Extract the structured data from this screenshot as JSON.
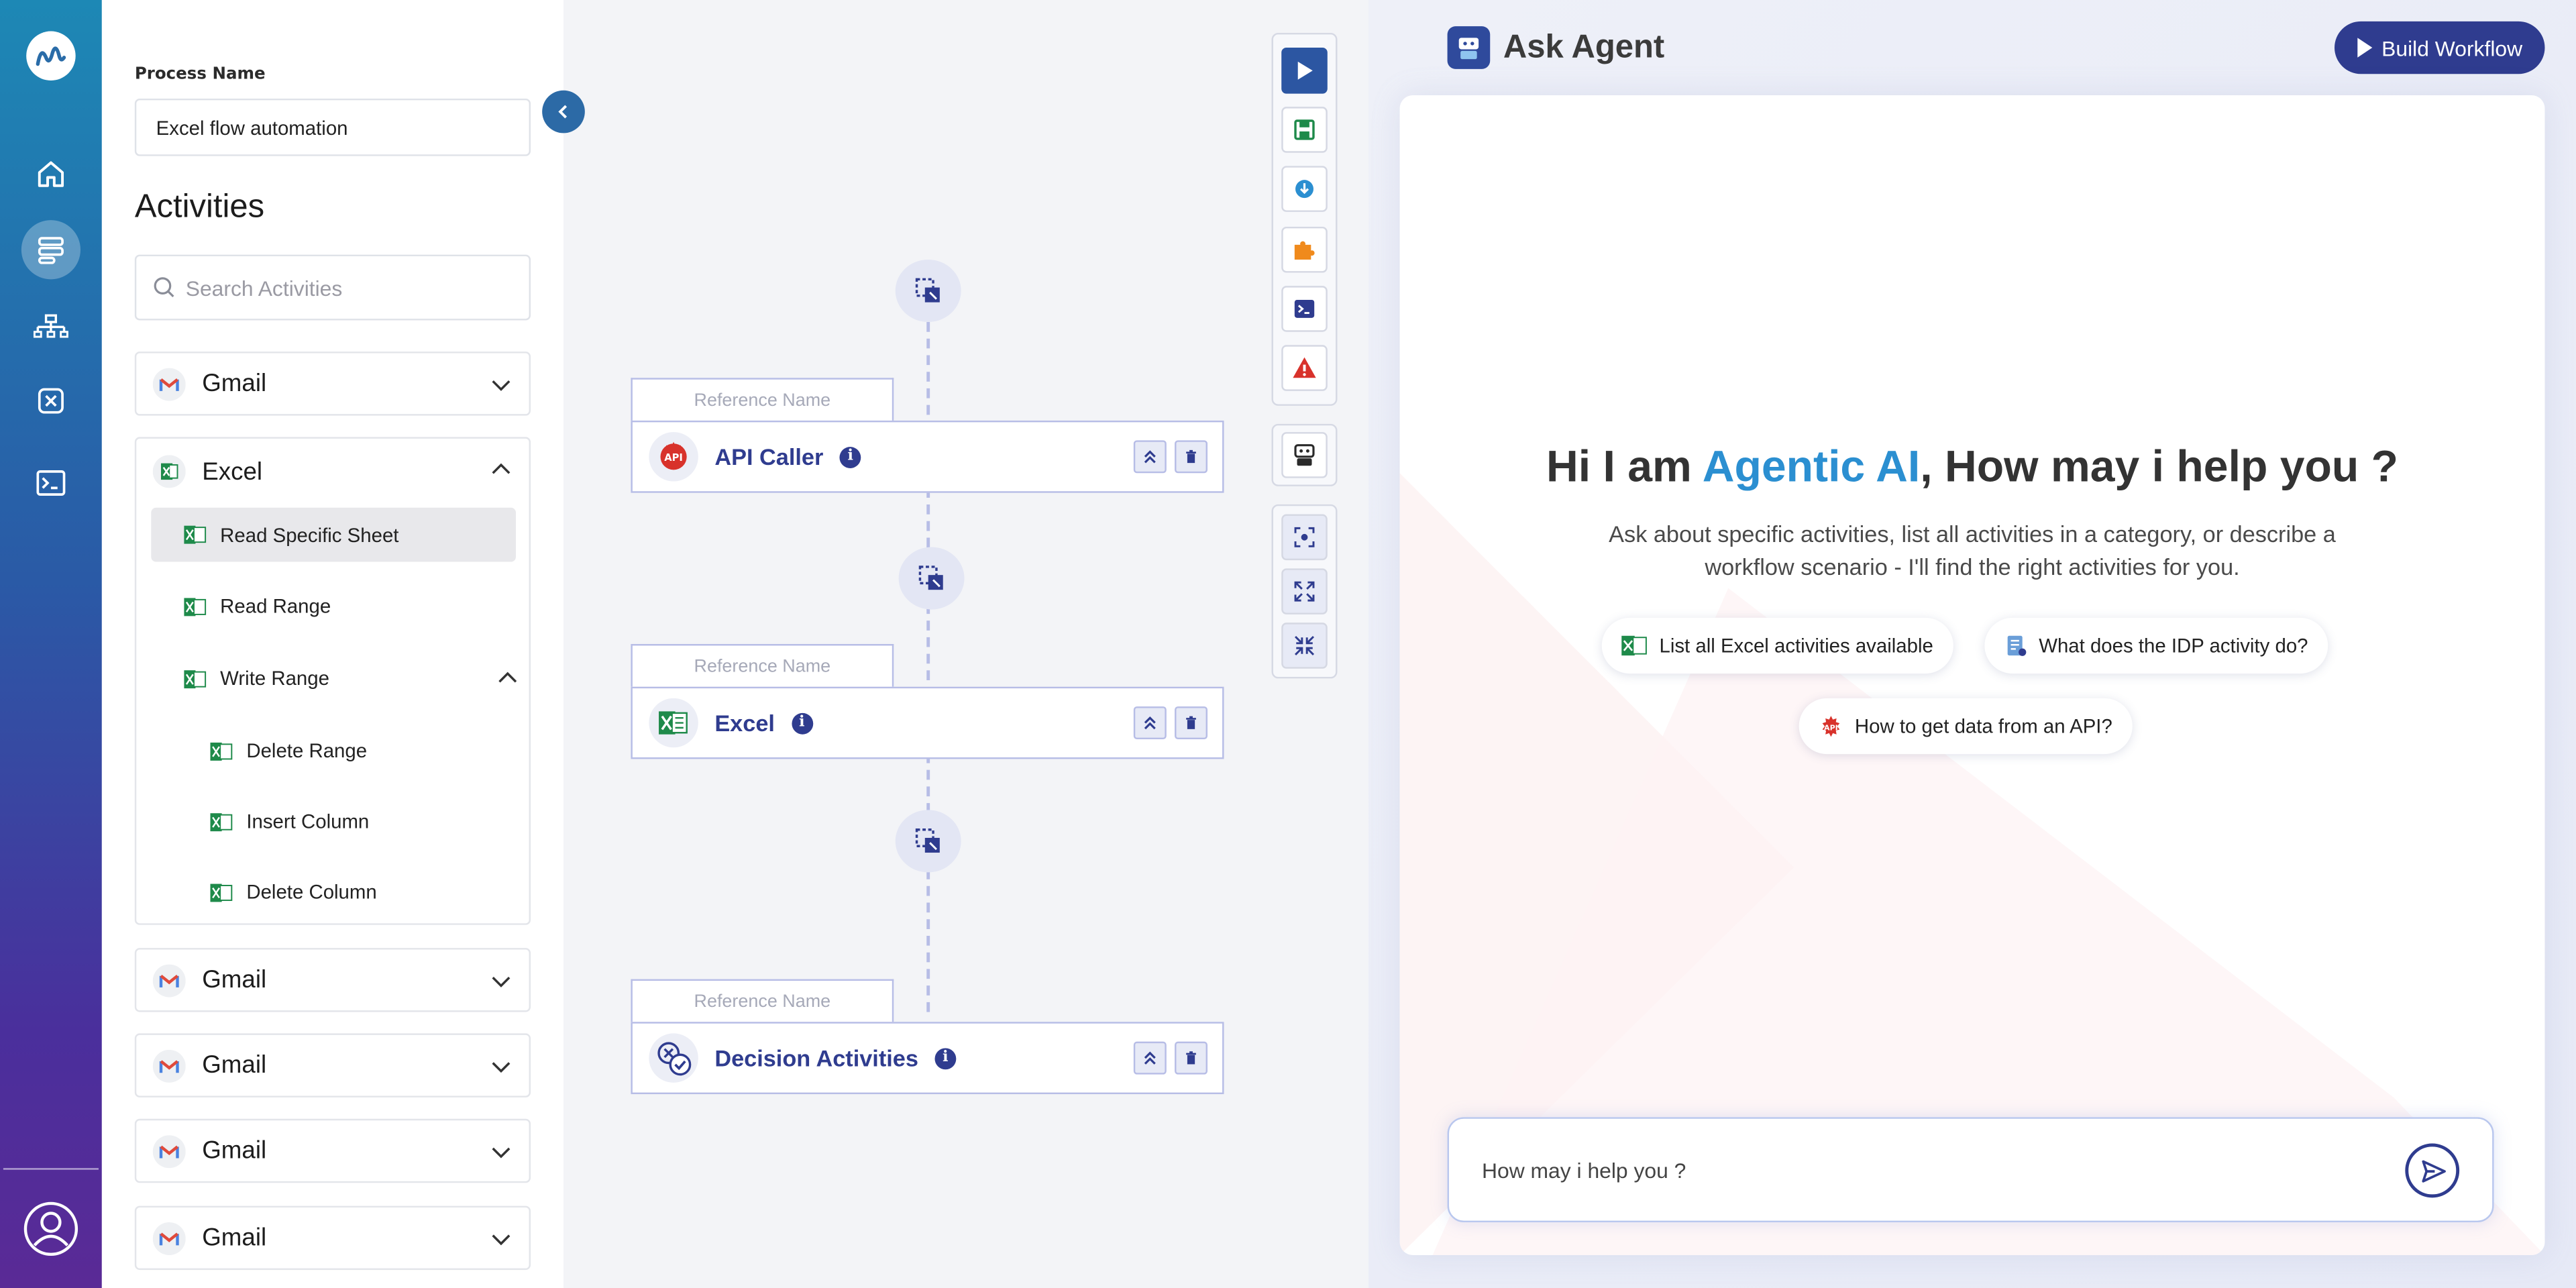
{
  "sidebar": {
    "process_name_label": "Process Name",
    "process_name_value": "Excel flow automation",
    "activities_title": "Activities",
    "search_placeholder": "Search Activities",
    "groups": [
      {
        "name": "Gmail"
      },
      {
        "name": "Excel"
      },
      {
        "name": "Gmail"
      },
      {
        "name": "Gmail"
      },
      {
        "name": "Gmail"
      },
      {
        "name": "Gmail"
      }
    ],
    "excel_items": [
      {
        "label": "Read Specific Sheet"
      },
      {
        "label": "Read Range"
      },
      {
        "label": "Write Range"
      },
      {
        "label": "Delete Range"
      },
      {
        "label": "Insert Column"
      },
      {
        "label": "Delete Column"
      }
    ]
  },
  "canvas": {
    "reference_placeholder": "Reference Name",
    "activities": [
      {
        "name": "API Caller"
      },
      {
        "name": "Excel"
      },
      {
        "name": "Decision Activities"
      }
    ],
    "info_glyph": "i"
  },
  "agent": {
    "title": "Ask Agent",
    "build_button": "Build Workflow",
    "greeting_pre": "Hi I am ",
    "greeting_highlight": "Agentic AI",
    "greeting_post": ", How may i help you ?",
    "subtitle": "Ask about specific activities, list all activities in a category, or describe a workflow scenario - I'll find the right activities for you.",
    "chips": [
      {
        "label": "List all Excel activities available"
      },
      {
        "label": "What does the IDP activity do?"
      },
      {
        "label": "How to get data from an API?"
      }
    ],
    "input_placeholder": "How may i help you ?"
  },
  "colors": {
    "accent": "#2f3c8f",
    "highlight": "#2b8fd1",
    "rail_top": "#1d88b5",
    "rail_bottom": "#5a2a96"
  }
}
